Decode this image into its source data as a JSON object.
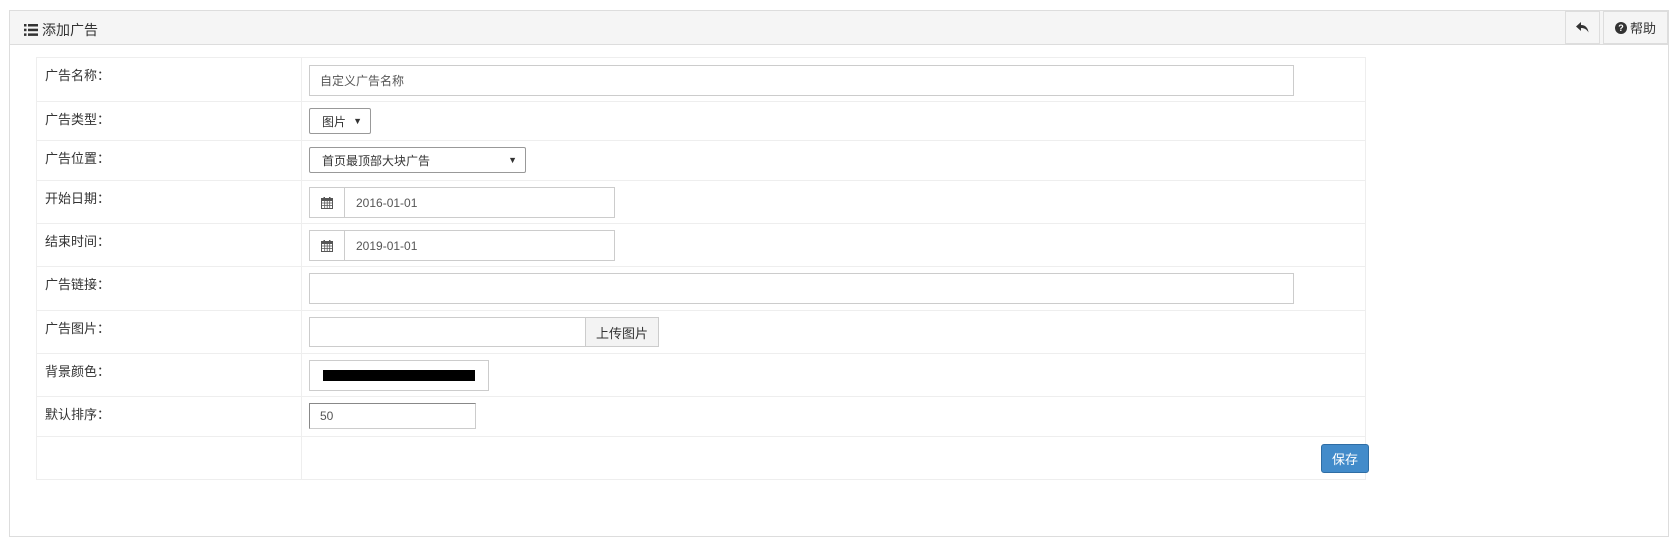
{
  "header": {
    "title": "添加广告",
    "title_icon": "list-icon",
    "back_icon": "reply-icon",
    "help_label": "帮助",
    "help_icon": "question-circle-icon"
  },
  "form": {
    "name": {
      "label": "广告名称：",
      "placeholder": "自定义广告名称",
      "value": ""
    },
    "type": {
      "label": "广告类型：",
      "selected": "图片"
    },
    "position": {
      "label": "广告位置：",
      "selected": "首页最顶部大块广告"
    },
    "start_date": {
      "label": "开始日期：",
      "value": "2016-01-01",
      "icon": "calendar-icon"
    },
    "end_date": {
      "label": "结束时间：",
      "value": "2019-01-01",
      "icon": "calendar-icon"
    },
    "link": {
      "label": "广告链接：",
      "value": ""
    },
    "image": {
      "label": "广告图片：",
      "value": "",
      "upload_label": "上传图片"
    },
    "bg_color": {
      "label": "背景颜色：",
      "color": "#000000"
    },
    "order": {
      "label": "默认排序：",
      "value": "50"
    },
    "save_label": "保存"
  },
  "colors": {
    "primary_button": "#428bca",
    "panel_header_bg": "#f5f5f5",
    "border": "#dddddd"
  }
}
